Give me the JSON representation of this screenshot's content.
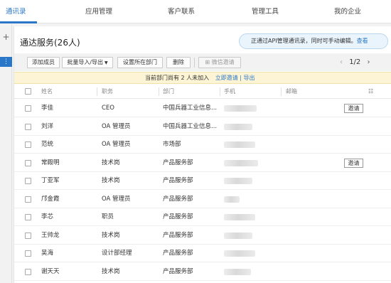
{
  "nav": {
    "tabs": [
      {
        "label": "通讯录",
        "active": true
      },
      {
        "label": "应用管理",
        "active": false
      },
      {
        "label": "客户联系",
        "active": false
      },
      {
        "label": "管理工具",
        "active": false
      },
      {
        "label": "我的企业",
        "active": false
      }
    ]
  },
  "rail": {
    "add_icon": "plus-icon",
    "more_icon": "vertical-dots-icon"
  },
  "main": {
    "title": "通达服务(26人)",
    "api_notice": {
      "text": "正通过API管理通讯录，同时可手动编辑。",
      "link": "查看"
    }
  },
  "toolbar": {
    "add_member": "添加成员",
    "bulk_import_export": "批量导入/导出",
    "set_department": "设置所在部门",
    "delete": "删除",
    "wechat_invite": "微信邀请",
    "pager": "1/2"
  },
  "notice": {
    "prefix": "当前部门尚有 2 人未加入",
    "invite_link": "立即邀请",
    "divider": "|",
    "export_link": "导出"
  },
  "table": {
    "headers": {
      "name": "姓名",
      "role": "职务",
      "dept": "部门",
      "phone": "手机",
      "email": "邮箱"
    },
    "invite_label": "邀请",
    "rows": [
      {
        "name": "李佳",
        "role": "CEO",
        "dept": "中国兵器工业信息...",
        "invite": true
      },
      {
        "name": "刘洋",
        "role": "OA 管理员",
        "dept": "中国兵器工业信息...",
        "invite": false
      },
      {
        "name": "范统",
        "role": "OA 管理员",
        "dept": "市场部",
        "invite": false
      },
      {
        "name": "常殿明",
        "role": "技术岗",
        "dept": "产品服务部",
        "invite": true
      },
      {
        "name": "丁亚军",
        "role": "技术岗",
        "dept": "产品服务部",
        "invite": false
      },
      {
        "name": "邝金霞",
        "role": "OA 管理员",
        "dept": "产品服务部",
        "invite": false
      },
      {
        "name": "李芯",
        "role": "职员",
        "dept": "产品服务部",
        "invite": false
      },
      {
        "name": "王帅龙",
        "role": "技术岗",
        "dept": "产品服务部",
        "invite": false
      },
      {
        "name": "吴海",
        "role": "设计部经理",
        "dept": "产品服务部",
        "invite": false
      },
      {
        "name": "谢天天",
        "role": "技术岗",
        "dept": "产品服务部",
        "invite": false
      }
    ]
  },
  "colors": {
    "accent": "#2a77c9",
    "notice_bg": "#fcf4d4",
    "api_notice_bg": "#eaf4fc"
  }
}
